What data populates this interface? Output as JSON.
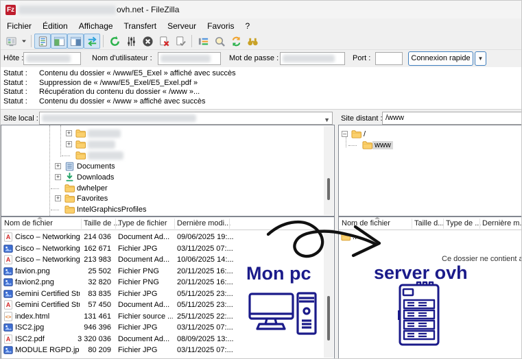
{
  "window": {
    "title": "ovh.net - FileZilla",
    "app_icon_text": "Fz"
  },
  "menu": {
    "items": [
      "Fichier",
      "Édition",
      "Affichage",
      "Transfert",
      "Serveur",
      "Favoris",
      "?"
    ]
  },
  "toolbar": {
    "groups": [
      [
        {
          "icon": "site-manager-icon",
          "pressed": false
        },
        {
          "icon": "dropdown-caret-icon",
          "pressed": false,
          "narrow": true
        }
      ],
      [
        {
          "icon": "toggle-log-icon",
          "pressed": true
        },
        {
          "icon": "toggle-local-tree-icon",
          "pressed": true
        },
        {
          "icon": "toggle-remote-tree-icon",
          "pressed": true
        },
        {
          "icon": "toggle-queue-icon",
          "pressed": true
        }
      ],
      [
        {
          "icon": "refresh-icon",
          "pressed": false
        },
        {
          "icon": "process-queue-icon",
          "pressed": false
        },
        {
          "icon": "cancel-icon",
          "pressed": false
        },
        {
          "icon": "delete-file-icon",
          "pressed": false
        },
        {
          "icon": "edit-file-icon",
          "pressed": false
        }
      ],
      [
        {
          "icon": "filter-icon",
          "pressed": false
        },
        {
          "icon": "compare-icon",
          "pressed": false
        },
        {
          "icon": "sync-browse-icon",
          "pressed": false
        },
        {
          "icon": "find-files-icon",
          "pressed": false
        }
      ]
    ]
  },
  "quickconnect": {
    "host_label": "Hôte :",
    "user_label": "Nom d'utilisateur :",
    "password_label": "Mot de passe :",
    "port_label": "Port :",
    "connect_button": "Connexion rapide"
  },
  "status_log": [
    {
      "label": "Statut :",
      "message": "Contenu du dossier « /www/E5_Exel » affiché avec succès"
    },
    {
      "label": "Statut :",
      "message": "Suppression de « /www/E5_Exel/E5_Exel.pdf »"
    },
    {
      "label": "Statut :",
      "message": "Récupération du contenu du dossier « /www »..."
    },
    {
      "label": "Statut :",
      "message": "Contenu du dossier « /www » affiché avec succès"
    }
  ],
  "local_panel": {
    "label": "Site local :",
    "tree": [
      {
        "name": "",
        "icon": "folder-icon",
        "expander": "plus",
        "indent": 2,
        "redacted": true,
        "blur_w": 48
      },
      {
        "name": "",
        "icon": "folder-icon",
        "expander": "plus",
        "indent": 2,
        "redacted": true,
        "blur_w": 40
      },
      {
        "name": "",
        "icon": "folder-icon",
        "expander": "none",
        "indent": 2,
        "redacted": true,
        "blur_w": 52
      },
      {
        "name": "Documents",
        "icon": "documents-icon",
        "expander": "plus",
        "indent": 1
      },
      {
        "name": "Downloads",
        "icon": "downloads-icon",
        "expander": "plus",
        "indent": 1
      },
      {
        "name": "dwhelper",
        "icon": "folder-icon",
        "expander": "none",
        "indent": 1
      },
      {
        "name": "Favorites",
        "icon": "folder-icon",
        "expander": "plus",
        "indent": 1
      },
      {
        "name": "IntelGraphicsProfiles",
        "icon": "folder-icon",
        "expander": "none",
        "indent": 1
      },
      {
        "name": "",
        "icon": "folder-icon",
        "expander": "none",
        "indent": 1,
        "partial": true
      }
    ],
    "columns": [
      "Nom de fichier",
      "Taille de ...",
      "Type de fichier",
      "Dernière modi..."
    ],
    "files": [
      {
        "name": "Cisco – Networking ...",
        "size": "214 036",
        "type": "Document Ad...",
        "modified": "09/06/2025 19:...",
        "icon": "pdf-icon"
      },
      {
        "name": "Cisco – Networking ...",
        "size": "162 671",
        "type": "Fichier JPG",
        "modified": "03/11/2025 07:...",
        "icon": "image-icon"
      },
      {
        "name": "Cisco – Networking ...",
        "size": "213 983",
        "type": "Document Ad...",
        "modified": "10/06/2025 14:...",
        "icon": "pdf-icon"
      },
      {
        "name": "favion.png",
        "size": "25 502",
        "type": "Fichier PNG",
        "modified": "20/11/2025 16:...",
        "icon": "image-icon"
      },
      {
        "name": "favion2.png",
        "size": "32 820",
        "type": "Fichier PNG",
        "modified": "20/11/2025 16:...",
        "icon": "image-icon"
      },
      {
        "name": "Gemini Certified Stu...",
        "size": "83 835",
        "type": "Fichier JPG",
        "modified": "05/11/2025 23:...",
        "icon": "image-icon"
      },
      {
        "name": "Gemini Certified Stu...",
        "size": "57 450",
        "type": "Document Ad...",
        "modified": "05/11/2025 23:...",
        "icon": "pdf-icon"
      },
      {
        "name": "index.html",
        "size": "131 461",
        "type": "Fichier source ...",
        "modified": "25/11/2025 22:...",
        "icon": "html-icon"
      },
      {
        "name": "ISC2.jpg",
        "size": "946 396",
        "type": "Fichier JPG",
        "modified": "03/11/2025 07:...",
        "icon": "image-icon"
      },
      {
        "name": "ISC2.pdf",
        "size": "3 320 036",
        "type": "Document Ad...",
        "modified": "08/09/2025 13:...",
        "icon": "pdf-icon"
      },
      {
        "name": "MODULE RGPD.jpg",
        "size": "80 209",
        "type": "Fichier JPG",
        "modified": "03/11/2025 07:...",
        "icon": "image-icon"
      }
    ]
  },
  "remote_panel": {
    "label": "Site distant :",
    "path": "/www",
    "tree": [
      {
        "name": "/",
        "icon": "folder-icon",
        "expander": "minus",
        "indent": 0
      },
      {
        "name": "www",
        "icon": "folder-icon",
        "expander": "none",
        "indent": 1,
        "selected": true
      }
    ],
    "columns": [
      "Nom de fichier",
      "Taille d...",
      "Type de ...",
      "Dernière m..."
    ],
    "files": [
      {
        "name": "..",
        "size": "",
        "type": "",
        "modified": "",
        "icon": "folder-icon"
      }
    ],
    "empty_message": "Ce dossier ne contient au"
  },
  "annotations": {
    "left_label": "Mon pc",
    "right_label": "server ovh",
    "color": "#1b1b8a",
    "arrow_color": "#111111"
  }
}
